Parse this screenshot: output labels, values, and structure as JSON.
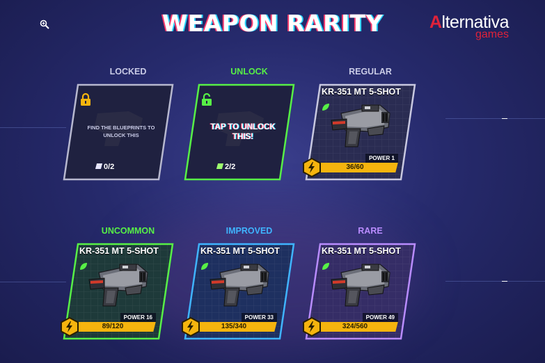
{
  "title": "WEAPON RARITY",
  "logo": {
    "line1_accent": "A",
    "line1_rest": "lternativa",
    "line2": "games"
  },
  "icons": {
    "zoom": "zoom-in-icon"
  },
  "colors": {
    "locked": "#c8c8e0",
    "unlock": "#57f046",
    "regular": "#c8c8e0",
    "uncommon": "#57f046",
    "improved": "#3fb4ff",
    "rare": "#b98cff",
    "bar": "#f5b40e"
  },
  "cards": {
    "locked": {
      "label": "LOCKED",
      "text": "FIND THE BLUEPRINTS TO UNLOCK THIS",
      "blueprints": "0/2",
      "icon": "padlock-locked-icon"
    },
    "unlock": {
      "label": "UNLOCK",
      "text": "TAP TO UNLOCK THIS!",
      "blueprints": "2/2",
      "icon": "padlock-open-icon"
    },
    "regular": {
      "label": "REGULAR",
      "name": "KR-351 MT 5-SHOT",
      "power": "POWER 1",
      "progress": "36/60",
      "fraction": 0.6
    },
    "uncommon": {
      "label": "UNCOMMON",
      "name": "KR-351 MT 5-SHOT",
      "power": "POWER 16",
      "progress": "89/120",
      "fraction": 0.742
    },
    "improved": {
      "label": "IMPROVED",
      "name": "KR-351 MT 5-SHOT",
      "power": "POWER 33",
      "progress": "135/340",
      "fraction": 0.397
    },
    "rare": {
      "label": "RARE",
      "name": "KR-351 MT 5-SHOT",
      "power": "POWER 49",
      "progress": "324/560",
      "fraction": 0.579
    }
  }
}
